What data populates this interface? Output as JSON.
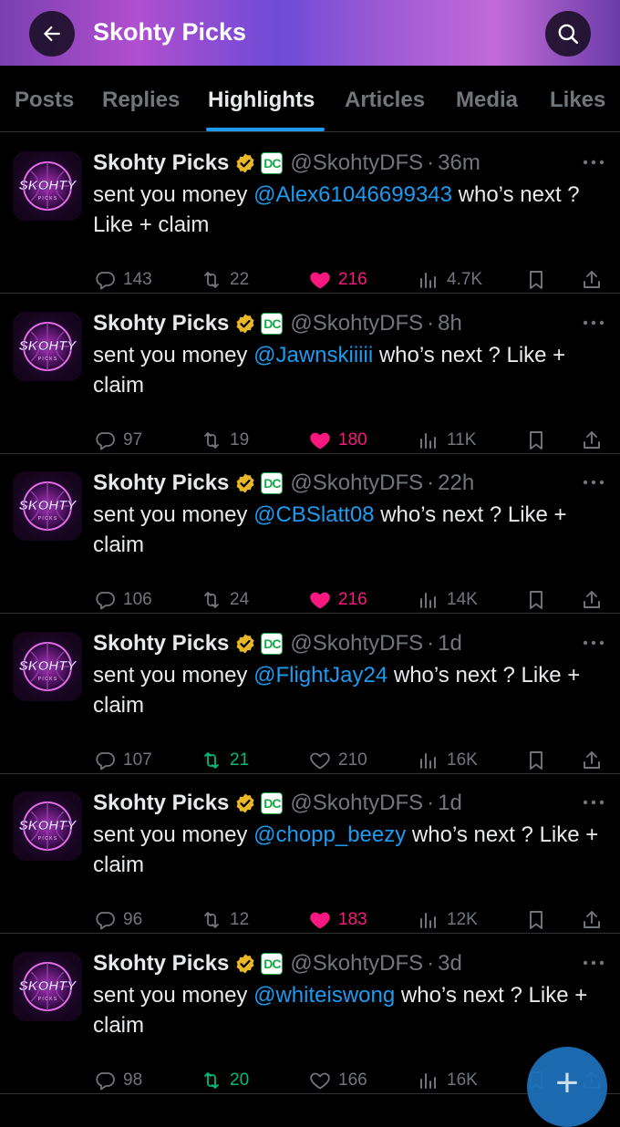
{
  "header": {
    "title": "Skohty Picks",
    "back_icon": "arrow-left-icon",
    "search_icon": "search-icon"
  },
  "tabs": [
    {
      "label": "Posts"
    },
    {
      "label": "Replies"
    },
    {
      "label": "Highlights"
    },
    {
      "label": "Articles"
    },
    {
      "label": "Media"
    },
    {
      "label": "Likes"
    }
  ],
  "active_tab": "Highlights",
  "avatar_text": "SKOHTY PICKS",
  "tweets": [
    {
      "name": "Skohty Picks",
      "badge": "DC",
      "handle": "@SkohtyDFS",
      "dot": "·",
      "time": "36m",
      "text_before": "sent you money ",
      "mention": "@Alex61046699343",
      "text_after": " who’s next ? Like + claim",
      "replies": "143",
      "reposts": "22",
      "likes": "216",
      "views": "4.7K",
      "liked": true,
      "reposted": false
    },
    {
      "name": "Skohty Picks",
      "badge": "DC",
      "handle": "@SkohtyDFS",
      "dot": "·",
      "time": "8h",
      "text_before": "sent you money ",
      "mention": "@Jawnskiiiii",
      "text_after": " who’s next ? Like + claim",
      "replies": "97",
      "reposts": "19",
      "likes": "180",
      "views": "11K",
      "liked": true,
      "reposted": false
    },
    {
      "name": "Skohty Picks",
      "badge": "DC",
      "handle": "@SkohtyDFS",
      "dot": "·",
      "time": "22h",
      "text_before": "sent you money ",
      "mention": "@CBSlatt08",
      "text_after": " who’s next ? Like + claim",
      "replies": "106",
      "reposts": "24",
      "likes": "216",
      "views": "14K",
      "liked": true,
      "reposted": false
    },
    {
      "name": "Skohty Picks",
      "badge": "DC",
      "handle": "@SkohtyDFS",
      "dot": "·",
      "time": "1d",
      "text_before": "sent you money ",
      "mention": "@FlightJay24",
      "text_after": " who’s next ? Like + claim",
      "replies": "107",
      "reposts": "21",
      "likes": "210",
      "views": "16K",
      "liked": false,
      "reposted": true
    },
    {
      "name": "Skohty Picks",
      "badge": "DC",
      "handle": "@SkohtyDFS",
      "dot": "·",
      "time": "1d",
      "text_before": "sent you money ",
      "mention": "@chopp_beezy",
      "text_after": " who’s next ? Like + claim",
      "replies": "96",
      "reposts": "12",
      "likes": "183",
      "views": "12K",
      "liked": true,
      "reposted": false
    },
    {
      "name": "Skohty Picks",
      "badge": "DC",
      "handle": "@SkohtyDFS",
      "dot": "·",
      "time": "3d",
      "text_before": "sent you money ",
      "mention": "@whiteiswong",
      "text_after": " who’s next ? Like + claim",
      "replies": "98",
      "reposts": "20",
      "likes": "166",
      "views": "16K",
      "liked": false,
      "reposted": true
    }
  ],
  "fab": {
    "label": "+",
    "icon": "compose-plus-icon"
  },
  "colors": {
    "accent": "#1d9bf0",
    "like": "#f91880",
    "repost": "#00ba7c",
    "muted": "#71767b",
    "background": "#000000"
  }
}
